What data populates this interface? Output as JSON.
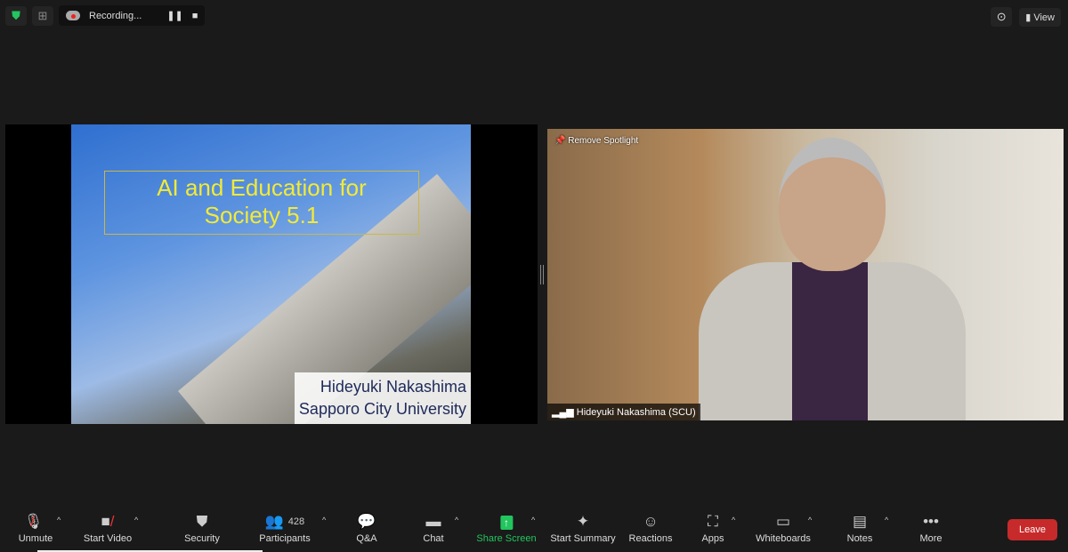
{
  "topbar": {
    "recording_label": "Recording...",
    "view_label": "View"
  },
  "slide": {
    "title_line1": "AI and Education for",
    "title_line2": "Society 5.1",
    "author": "Hideyuki Nakashima",
    "affiliation": "Sapporo City University"
  },
  "video": {
    "spotlight_label": "Remove Spotlight",
    "name": "Hideyuki Nakashima (SCU)"
  },
  "toolbar": {
    "items": [
      {
        "label": "Unmute",
        "icon": "mic-muted-icon"
      },
      {
        "label": "Start Video",
        "icon": "video-off-icon"
      },
      {
        "label": "Security",
        "icon": "shield-icon"
      },
      {
        "label": "Participants",
        "icon": "participants-icon",
        "count": "428"
      },
      {
        "label": "Q&A",
        "icon": "qa-icon"
      },
      {
        "label": "Chat",
        "icon": "chat-icon"
      },
      {
        "label": "Share Screen",
        "icon": "share-screen-icon"
      },
      {
        "label": "Start Summary",
        "icon": "summary-icon"
      },
      {
        "label": "Reactions",
        "icon": "reactions-icon"
      },
      {
        "label": "Apps",
        "icon": "apps-icon"
      },
      {
        "label": "Whiteboards",
        "icon": "whiteboard-icon"
      },
      {
        "label": "Notes",
        "icon": "notes-icon"
      },
      {
        "label": "More",
        "icon": "more-icon"
      }
    ],
    "leave_label": "Leave"
  },
  "colors": {
    "accent_green": "#22c55e",
    "leave_red": "#c72a2a",
    "slide_title": "#f2ea36"
  }
}
